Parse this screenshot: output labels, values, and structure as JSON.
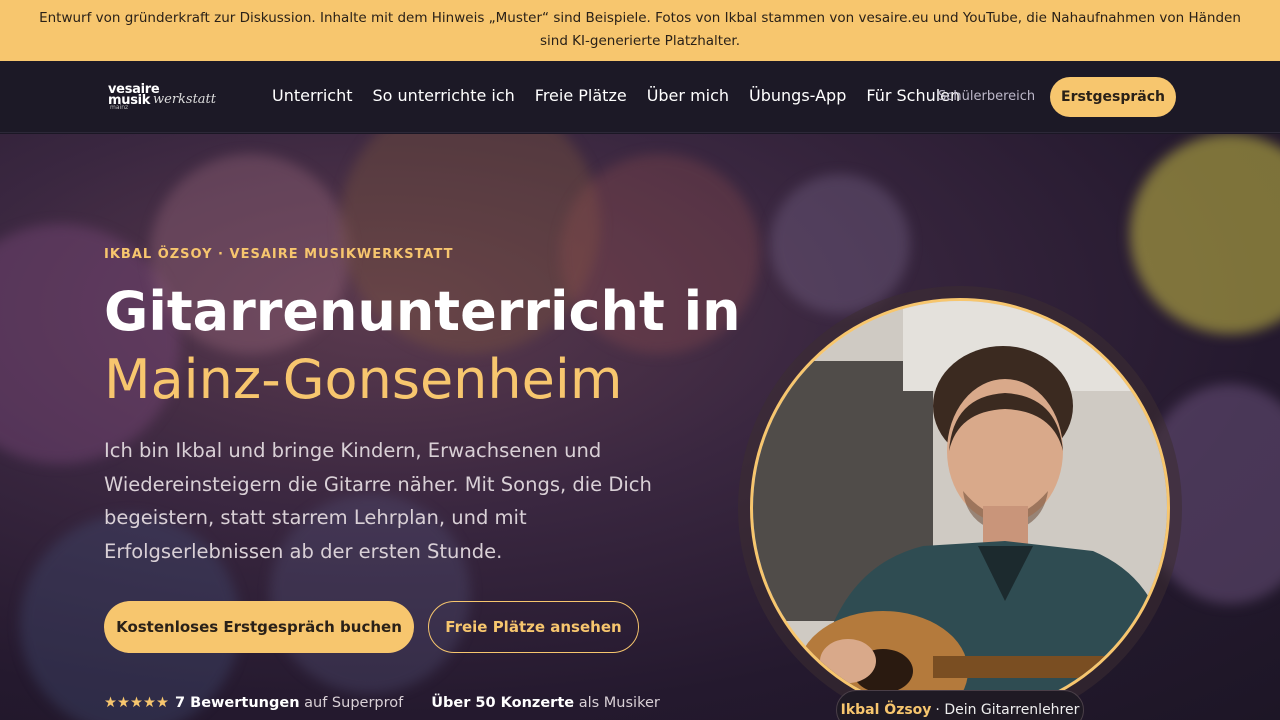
{
  "banner": {
    "text": "Entwurf von gründerkraft zur Diskussion. Inhalte mit dem Hinweis „Muster“ sind Beispiele. Fotos von Ikbal stammen von vesaire.eu und YouTube, die Nahaufnahmen von Händen sind KI-generierte Platzhalter."
  },
  "logo": {
    "line1": "vesaire",
    "line2": "musik",
    "line3": "werkstatt",
    "line4": "mainz"
  },
  "nav": {
    "items": [
      {
        "label": "Unterricht"
      },
      {
        "label": "So unterrichte ich"
      },
      {
        "label": "Freie Plätze"
      },
      {
        "label": "Über mich"
      },
      {
        "label": "Übungs-App"
      },
      {
        "label": "Für Schulen"
      }
    ],
    "student_area": "Schülerbereich",
    "cta": "Erstgespräch"
  },
  "hero": {
    "eyebrow": "IKBAL ÖZSOY · VESAIRE MUSIKWERKSTATT",
    "title_line1": "Gitarrenunterricht in",
    "title_line2": "Mainz-Gonsenheim",
    "lead": "Ich bin Ikbal und bringe Kindern, Erwachsenen und Wiedereinsteigern die Gitarre näher. Mit Songs, die Dich begeistern, statt starrem Lehrplan, und mit Erfolgserlebnissen ab der ersten Stunde.",
    "primary_button": "Kostenloses Erstgespräch buchen",
    "secondary_button": "Freie Plätze ansehen",
    "rating": {
      "stars": "★★★★★",
      "count": "7 Bewertungen",
      "suffix": "auf Superprof",
      "star_count": 5
    },
    "concerts": {
      "bold": "Über 50 Konzerte",
      "suffix": "als Musiker"
    },
    "caption": {
      "name": "Ikbal Özsoy",
      "role": "· Dein Gitarrenlehrer"
    }
  },
  "colors": {
    "accent": "#f7c66e",
    "banner": "#f7c66e",
    "nav_bg": "#1c1926"
  }
}
